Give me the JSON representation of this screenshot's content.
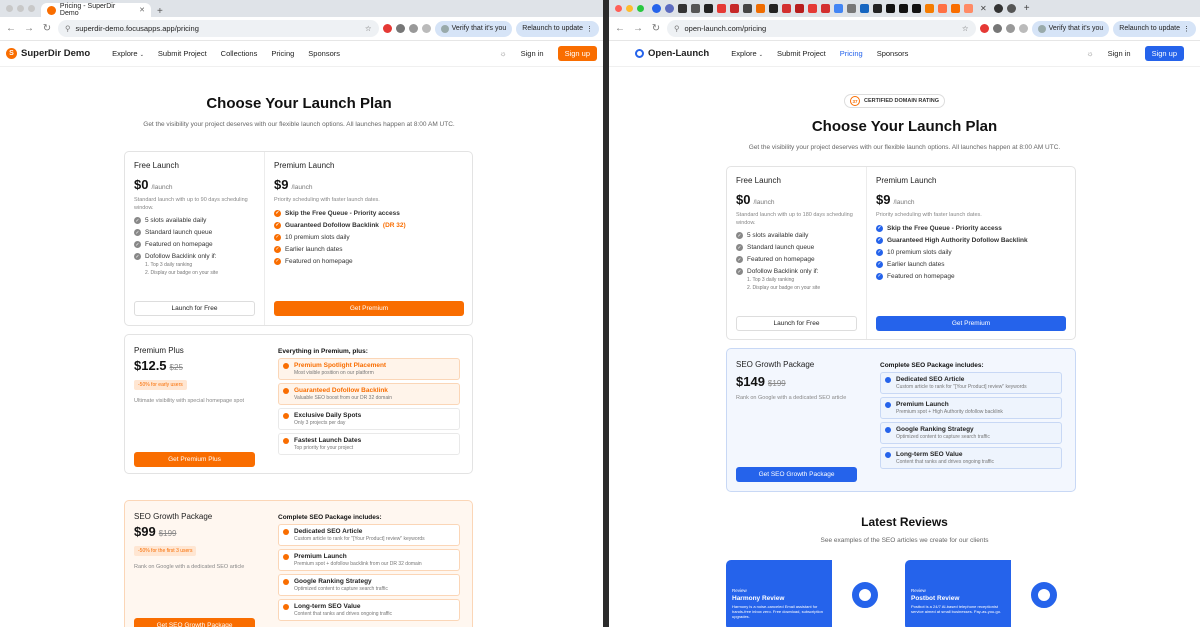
{
  "left": {
    "tab_title": "Pricing - SuperDir Demo",
    "url": "superdir-demo.focusapps.app/pricing",
    "verify_label": "Verify that it's you",
    "relaunch_label": "Relaunch to update",
    "brand": "SuperDir Demo",
    "nav": [
      "Explore",
      "Submit Project",
      "Collections",
      "Pricing",
      "Sponsors"
    ],
    "signin": "Sign in",
    "signup": "Sign up",
    "title": "Choose Your Launch Plan",
    "subtitle": "Get the visibility your project deserves with our flexible launch options. All launches happen at 8:00 AM UTC.",
    "free": {
      "name": "Free Launch",
      "price": "$0",
      "per": "/launch",
      "desc": "Standard launch with up to 90 days scheduling window.",
      "features": [
        "5 slots available daily",
        "Standard launch queue",
        "Featured on homepage",
        "Dofollow Backlink only if:"
      ],
      "sub": [
        "1. Top 3 daily ranking",
        "2. Display our badge on your site"
      ],
      "button": "Launch for Free"
    },
    "premium": {
      "name": "Premium Launch",
      "price": "$9",
      "per": "/launch",
      "desc": "Priority scheduling with faster launch dates.",
      "features": [
        "Skip the Free Queue - Priority access",
        "Guaranteed Dofollow Backlink",
        "10 premium slots daily",
        "Earlier launch dates",
        "Featured on homepage"
      ],
      "dr": "(DR 32)",
      "button": "Get Premium"
    },
    "plus": {
      "name": "Premium Plus",
      "price": "$12.5",
      "old": "$25",
      "badge": "-50% for early users",
      "desc": "Ultimate visibility with special homepage spot",
      "button": "Get Premium Plus",
      "heading": "Everything in Premium, plus:",
      "items": [
        {
          "t": "Premium Spotlight Placement",
          "d": "Most visible position on our platform"
        },
        {
          "t": "Guaranteed Dofollow Backlink",
          "d": "Valuable SEO boost from our DR 32 domain"
        },
        {
          "t": "Exclusive Daily Spots",
          "d": "Only 3 projects per day"
        },
        {
          "t": "Fastest Launch Dates",
          "d": "Top priority for your project"
        }
      ]
    },
    "seo": {
      "name": "SEO Growth Package",
      "price": "$99",
      "old": "$199",
      "badge": "-50% for the first 3 users",
      "desc": "Rank on Google with a dedicated SEO article",
      "button": "Get SEO Growth Package",
      "heading": "Complete SEO Package includes:",
      "items": [
        {
          "t": "Dedicated SEO Article",
          "d": "Custom article to rank for \"[Your Product] review\" keywords"
        },
        {
          "t": "Premium Launch",
          "d": "Premium spot + dofollow backlink from our DR 32 domain"
        },
        {
          "t": "Google Ranking Strategy",
          "d": "Optimized content to capture search traffic"
        },
        {
          "t": "Long-term SEO Value",
          "d": "Content that ranks and drives ongoing traffic"
        }
      ]
    }
  },
  "right": {
    "url": "open-launch.com/pricing",
    "verify_label": "Verify that it's you",
    "relaunch_label": "Relaunch to update",
    "brand": "Open-Launch",
    "nav": [
      "Explore",
      "Submit Project",
      "Pricing",
      "Sponsors"
    ],
    "signin": "Sign in",
    "signup": "Sign up",
    "rating_num": "37",
    "rating": "CERTIFIED DOMAIN RATING",
    "title": "Choose Your Launch Plan",
    "subtitle": "Get the visibility your project deserves with our flexible launch options. All launches happen at 8:00 AM UTC.",
    "free": {
      "name": "Free Launch",
      "price": "$0",
      "per": "/launch",
      "desc": "Standard launch with up to 180 days scheduling window.",
      "features": [
        "5 slots available daily",
        "Standard launch queue",
        "Featured on homepage",
        "Dofollow Backlink only if:"
      ],
      "sub": [
        "1. Top 3 daily ranking",
        "2. Display our badge on your site"
      ],
      "button": "Launch for Free"
    },
    "premium": {
      "name": "Premium Launch",
      "price": "$9",
      "per": "/launch",
      "desc": "Priority scheduling with faster launch dates.",
      "features": [
        "Skip the Free Queue - Priority access",
        "Guaranteed High Authority Dofollow Backlink",
        "10 premium slots daily",
        "Earlier launch dates",
        "Featured on homepage"
      ],
      "button": "Get Premium"
    },
    "seo": {
      "name": "SEO Growth Package",
      "price": "$149",
      "old": "$199",
      "desc": "Rank on Google with a dedicated SEO article",
      "button": "Get SEO Growth Package",
      "heading": "Complete SEO Package includes:",
      "items": [
        {
          "t": "Dedicated SEO Article",
          "d": "Custom article to rank for \"[Your Product] review\" keywords"
        },
        {
          "t": "Premium Launch",
          "d": "Premium spot + High Authority dofollow backlink"
        },
        {
          "t": "Google Ranking Strategy",
          "d": "Optimized content to capture search traffic"
        },
        {
          "t": "Long-term SEO Value",
          "d": "Content that ranks and drives ongoing traffic"
        }
      ]
    },
    "reviews_title": "Latest Reviews",
    "reviews_sub": "See examples of the SEO articles we create for our clients",
    "reviews": [
      {
        "tag": "Review",
        "t": "Harmony Review",
        "d": "Harmony is a noise-canceled Email assistant for hands-free inbox zero. Free download, subscription upgrades."
      },
      {
        "tag": "Review",
        "t": "Postbot Review",
        "d": "Postbot is a 24/7 AI-based telephone receptionist service aimed at small businesses. Pay-as-you-go."
      }
    ]
  },
  "colors": {
    "orange": "#f96d00",
    "blue": "#2563eb"
  }
}
